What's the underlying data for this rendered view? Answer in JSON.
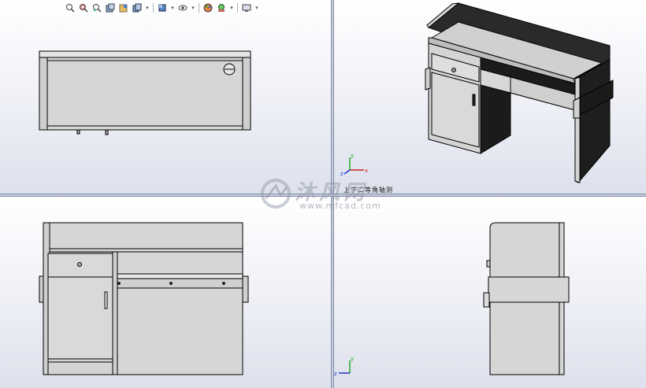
{
  "toolbar": {
    "items": [
      {
        "icon": "zoom-to-fit-icon"
      },
      {
        "icon": "zoom-to-area-icon"
      },
      {
        "icon": "previous-view-icon"
      },
      {
        "icon": "section-view-icon"
      },
      {
        "icon": "dynamic-annotation-icon"
      },
      {
        "icon": "view-orientation-icon",
        "dropdown": true
      },
      {
        "icon": "display-style-icon",
        "dropdown": true
      },
      {
        "icon": "hide-show-items-icon",
        "dropdown": true
      },
      {
        "icon": "edit-appearance-icon",
        "dropdown": true
      },
      {
        "icon": "apply-scene-icon",
        "dropdown": true
      },
      {
        "icon": "view-settings-icon",
        "dropdown": true
      }
    ]
  },
  "viewports": {
    "top_left": {
      "view": "front"
    },
    "top_right": {
      "view": "isometric",
      "label": "上下二等角轴测"
    },
    "bottom_left": {
      "view": "back"
    },
    "bottom_right": {
      "view": "side"
    }
  },
  "triad": {
    "x": "x",
    "y": "y",
    "z": "z"
  },
  "watermark": {
    "title": "沐风网",
    "url": "www.mfcad.com"
  },
  "colors": {
    "part_fill": "#d6d6d6",
    "part_dark": "#1c1c1c",
    "edge": "#000000",
    "axis_x": "#cc2222",
    "axis_y": "#22aa22",
    "axis_z": "#2233cc"
  }
}
